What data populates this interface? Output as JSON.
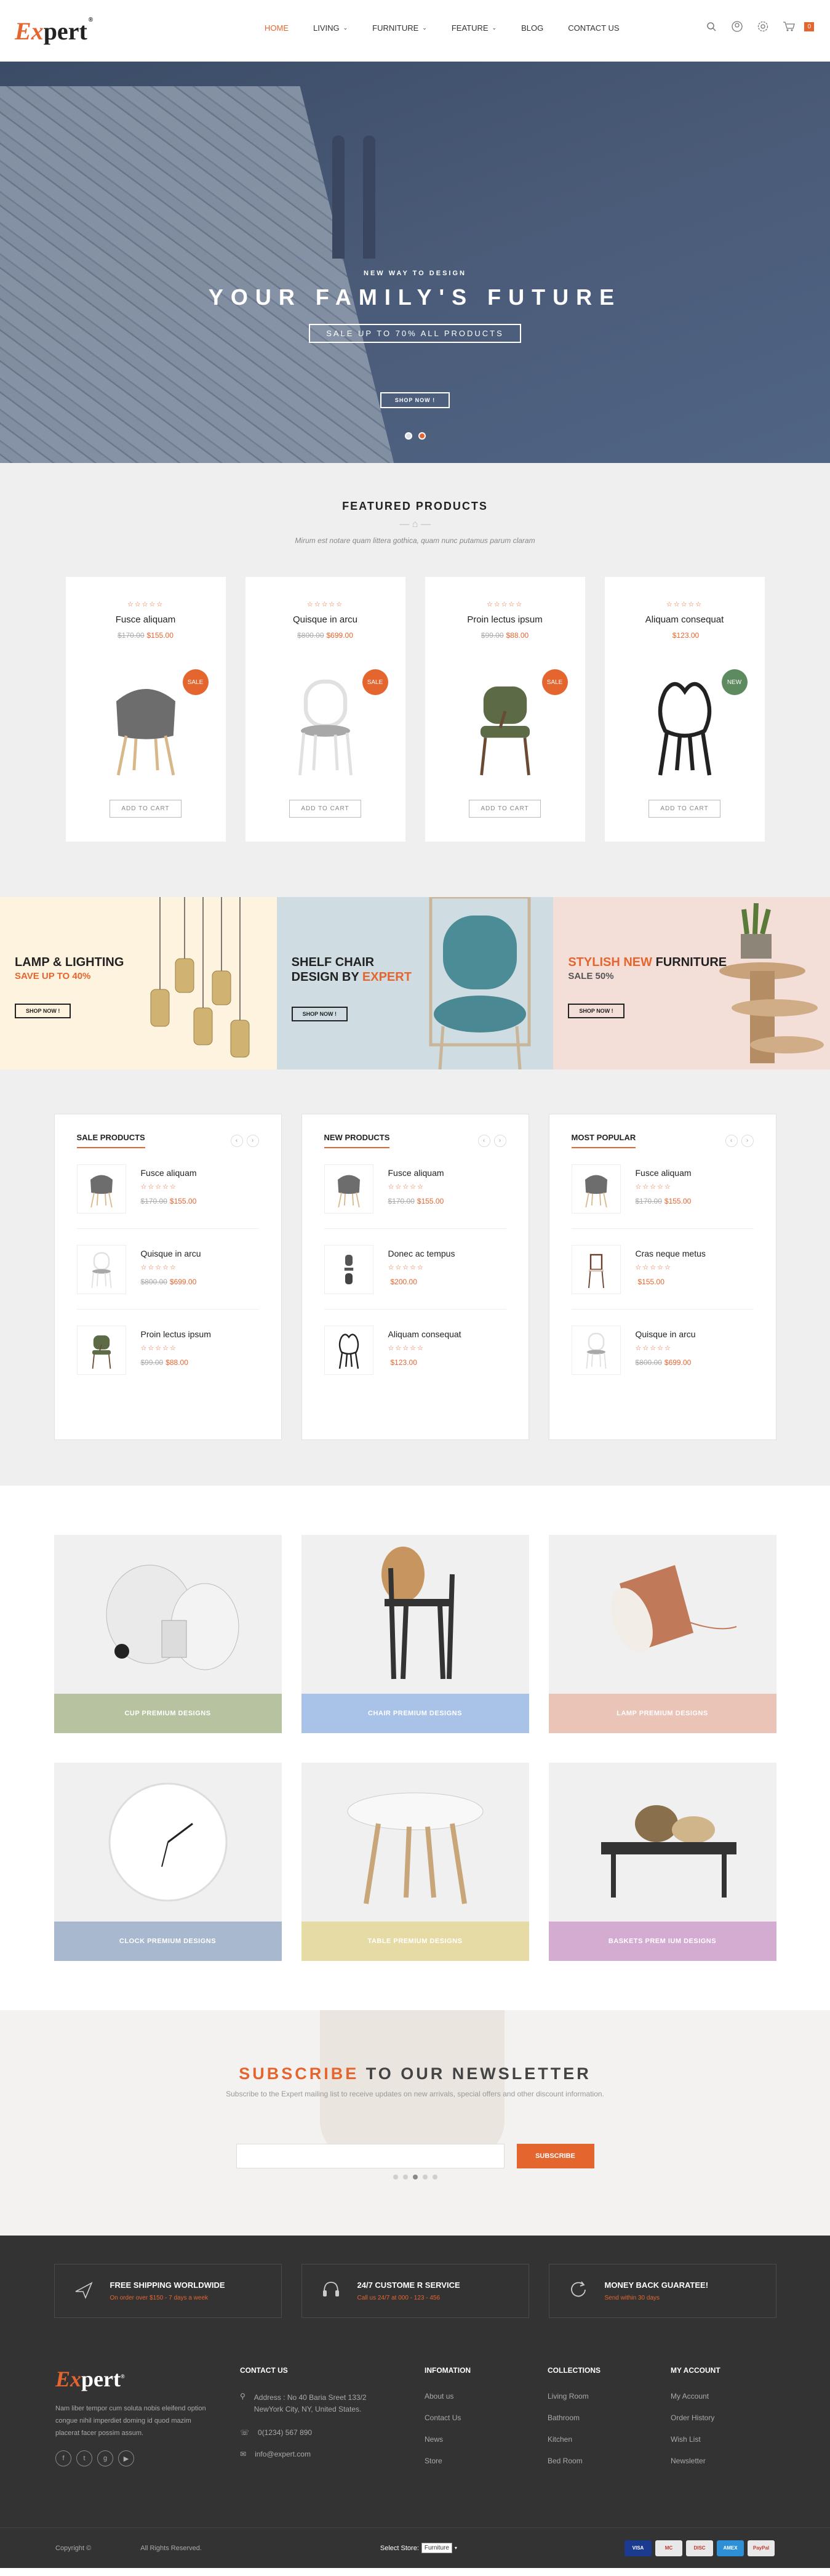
{
  "header": {
    "logo_ex": "Ex",
    "logo_rest": "pert",
    "nav": [
      {
        "label": "HOME",
        "active": true,
        "dropdown": false
      },
      {
        "label": "LIVING",
        "active": false,
        "dropdown": true
      },
      {
        "label": "FURNITURE",
        "active": false,
        "dropdown": true
      },
      {
        "label": "FEATURE",
        "active": false,
        "dropdown": true
      },
      {
        "label": "BLOG",
        "active": false,
        "dropdown": false
      },
      {
        "label": "CONTACT US",
        "active": false,
        "dropdown": false
      }
    ],
    "cart_count": "0"
  },
  "hero": {
    "sub": "NEW WAY TO DESIGN",
    "title": "YOUR FAMILY'S FUTURE",
    "sale": "SALE UP TO 70% ALL PRODUCTS",
    "button": "SHOP NOW !"
  },
  "featured": {
    "title": "FEATURED PRODUCTS",
    "subtitle": "Mirum est notare quam littera gothica, quam nunc putamus parum claram",
    "products": [
      {
        "name": "Fusce aliquam",
        "old_price": "$170.00",
        "price": "$155.00",
        "badge": "SALE",
        "button": "ADD TO CART"
      },
      {
        "name": "Quisque in arcu",
        "old_price": "$800.00",
        "price": "$699.00",
        "badge": "SALE",
        "button": "ADD TO CART"
      },
      {
        "name": "Proin lectus ipsum",
        "old_price": "$99.00",
        "price": "$88.00",
        "badge": "SALE",
        "button": "ADD TO CART"
      },
      {
        "name": "Aliquam consequat",
        "old_price": "",
        "price": "$123.00",
        "badge": "NEW",
        "button": "ADD TO CART"
      }
    ]
  },
  "banners": [
    {
      "title_a": "LAMP & LIGHTING",
      "title_b": "",
      "sub": "SAVE UP TO 40%",
      "button": "SHOP NOW !"
    },
    {
      "title_a": "SHELF CHAIR",
      "title_b": "DESIGN BY ",
      "title_or": "EXPERT",
      "button": "SHOP NOW !"
    },
    {
      "title_or": "STYLISH NEW ",
      "title_a": "FURNITURE",
      "sub": "SALE 50%",
      "button": "SHOP NOW !"
    }
  ],
  "lists": [
    {
      "title": "SALE PRODUCTS",
      "items": [
        {
          "name": "Fusce aliquam",
          "old_price": "$170.00",
          "price": "$155.00"
        },
        {
          "name": "Quisque in arcu",
          "old_price": "$800.00",
          "price": "$699.00"
        },
        {
          "name": "Proin lectus ipsum",
          "old_price": "$99.00",
          "price": "$88.00"
        }
      ]
    },
    {
      "title": "NEW PRODUCTS",
      "items": [
        {
          "name": "Fusce aliquam",
          "old_price": "$170.00",
          "price": "$155.00"
        },
        {
          "name": "Donec ac tempus",
          "old_price": "",
          "price": "$200.00"
        },
        {
          "name": "Aliquam consequat",
          "old_price": "",
          "price": "$123.00"
        }
      ]
    },
    {
      "title": "MOST POPULAR",
      "items": [
        {
          "name": "Fusce aliquam",
          "old_price": "$170.00",
          "price": "$155.00"
        },
        {
          "name": "Cras neque metus",
          "old_price": "",
          "price": "$155.00"
        },
        {
          "name": "Quisque in arcu",
          "old_price": "$800.00",
          "price": "$699.00"
        }
      ]
    }
  ],
  "categories": [
    {
      "label": "CUP PREMIUM DESIGNS",
      "color": "#b7c3a0"
    },
    {
      "label": "CHAIR PREMIUM DESIGNS",
      "color": "#a8c2e8"
    },
    {
      "label": "LAMP PREMIUM DESIGNS",
      "color": "#ebc4b8"
    },
    {
      "label": "CLOCK PREMIUM DESIGNS",
      "color": "#a8b8ce"
    },
    {
      "label": "TABLE PREMIUM DESIGNS",
      "color": "#e6dba5"
    },
    {
      "label": "BASKETS PREM IUM DESIGNS",
      "color": "#d4acd2"
    }
  ],
  "newsletter": {
    "title_or": "SUBSCRIBE",
    "title_rest": " TO OUR NEWSLETTER",
    "sub": "Subscribe to the Expert mailing list to receive updates on new arrivals, special offers and other discount information.",
    "button": "SUBSCRIBE"
  },
  "services": [
    {
      "title": "FREE SHIPPING WORLDWIDE",
      "sub": "On order over $150 - 7 days a week",
      "icon": "plane-icon"
    },
    {
      "title": "24/7 CUSTOME R SERVICE",
      "sub": "Call us 24/7 at 000 - 123 - 456",
      "icon": "headset-icon"
    },
    {
      "title": "MONEY BACK GUARATEE!",
      "sub": "Send within 30 days",
      "icon": "refresh-icon"
    }
  ],
  "footer": {
    "logo_ex": "Ex",
    "logo_rest": "pert",
    "desc": "Nam liber tempor cum soluta nobis eleifend option congue nihil imperdiet doming id quod mazim placerat facer possim assum.",
    "contact_title": "CONTACT US",
    "address": "Address : No 40 Baria Sreet 133/2 NewYork City, NY, United States.",
    "phone": "0(1234) 567 890",
    "email": "info@expert.com",
    "info_title": "INFOMATION",
    "info_links": [
      "About us",
      "Contact Us",
      "News",
      "Store"
    ],
    "coll_title": "COLLECTIONS",
    "coll_links": [
      "Living Room",
      "Bathroom",
      "Kitchen",
      "Bed Room"
    ],
    "acc_title": "MY ACCOUNT",
    "acc_links": [
      "My Account",
      "Order History",
      "Wish List",
      "Newsletter"
    ],
    "copyright": "Copyright ©",
    "rights": "All Rights Reserved.",
    "store_label": "Select Store:",
    "store_value": "Furniture",
    "payments": [
      {
        "label": "VISA",
        "color": "#1a3b8f"
      },
      {
        "label": "MC",
        "color": "#e8e8e8"
      },
      {
        "label": "DISC",
        "color": "#e8e8e8"
      },
      {
        "label": "AMEX",
        "color": "#2d8fd5"
      },
      {
        "label": "PayPal",
        "color": "#e8e8e8"
      }
    ]
  }
}
